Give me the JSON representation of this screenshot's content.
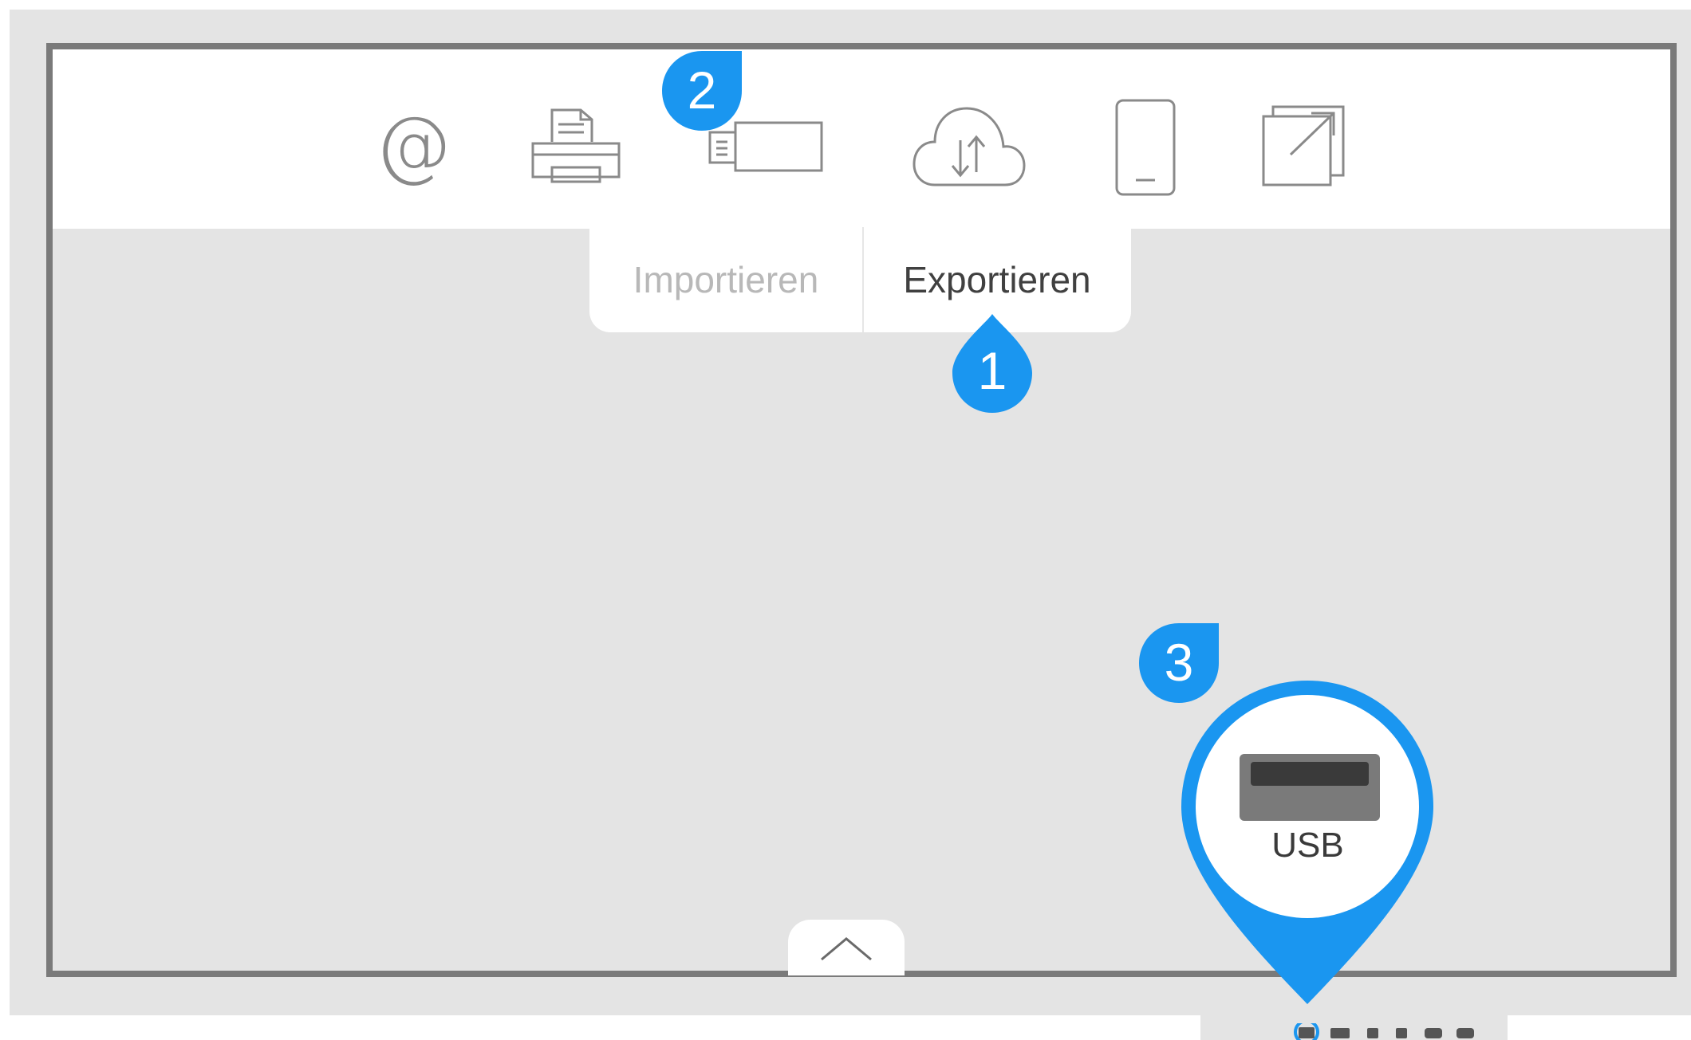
{
  "toolbar": {
    "icons": [
      {
        "name": "email-icon",
        "glyph": "@"
      },
      {
        "name": "printer-icon"
      },
      {
        "name": "usb-stick-icon"
      },
      {
        "name": "cloud-sync-icon"
      },
      {
        "name": "mobile-device-icon"
      },
      {
        "name": "external-share-icon"
      }
    ]
  },
  "tabs": {
    "import_label": "Importieren",
    "export_label": "Exportieren",
    "active": "Exportieren"
  },
  "callouts": [
    {
      "number": "1",
      "target": "Exportieren"
    },
    {
      "number": "2",
      "target": "usb-stick-icon"
    },
    {
      "number": "3",
      "target": "USB"
    }
  ],
  "usb_zoom": {
    "label": "USB"
  },
  "pagination": {
    "dots": 6,
    "active_index": 0
  },
  "colors": {
    "accent": "#1a96f0",
    "panel_bg": "#e4e4e4",
    "bezel": "#7a7a7a",
    "active_text": "#404040",
    "inactive_text": "#b8b8b8"
  }
}
